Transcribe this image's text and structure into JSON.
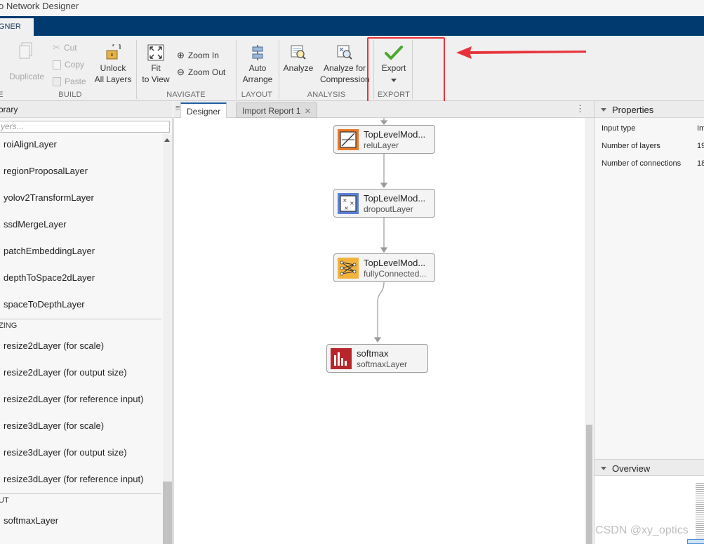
{
  "window": {
    "title": "o Network Designer"
  },
  "app_tab": {
    "label": "GNER"
  },
  "toolstrip": {
    "duplicate": "Duplicate",
    "cut": "Cut",
    "copy": "Copy",
    "paste": "Paste",
    "unlock_line1": "Unlock",
    "unlock_line2": "All Layers",
    "fit_line1": "Fit",
    "fit_line2": "to View",
    "zoom_in": "Zoom In",
    "zoom_out": "Zoom Out",
    "auto_line1": "Auto",
    "auto_line2": "Arrange",
    "analyze": "Analyze",
    "analyze_for_line1": "Analyze for",
    "analyze_for_line2": "Compression",
    "export": "Export",
    "sections": {
      "partial": "E",
      "build": "BUILD",
      "navigate": "NAVIGATE",
      "layout": "LAYOUT",
      "analysis": "ANALYSIS",
      "export": "EXPORT"
    }
  },
  "library": {
    "header": "orary",
    "search_placeholder": "yers...",
    "items": [
      "roiAlignLayer",
      "regionProposalLayer",
      "yolov2TransformLayer",
      "ssdMergeLayer",
      "patchEmbeddingLayer",
      "depthToSpace2dLayer",
      "spaceToDepthLayer"
    ],
    "category_resizing": "ZING",
    "resizing_items": [
      "resize2dLayer (for scale)",
      "resize2dLayer (for output size)",
      "resize2dLayer (for reference input)",
      "resize3dLayer (for scale)",
      "resize3dLayer (for output size)",
      "resize3dLayer (for reference input)"
    ],
    "category_output": "UT",
    "output_items": [
      "softmaxLayer"
    ]
  },
  "doc_tabs": {
    "designer": "Designer",
    "import_report": "Import Report 1",
    "close_glyph": "✕",
    "menu_glyph": "⋮",
    "grip_glyph": "≡"
  },
  "nodes": [
    {
      "name": "TopLevelMod...",
      "type": "reluLayer"
    },
    {
      "name": "TopLevelMod...",
      "type": "dropoutLayer"
    },
    {
      "name": "TopLevelMod...",
      "type": "fullyConnected..."
    },
    {
      "name": "softmax",
      "type": "softmaxLayer"
    }
  ],
  "properties": {
    "header": "Properties",
    "rows": [
      {
        "label": "Input type",
        "value": "Im"
      },
      {
        "label": "Number of layers",
        "value": "19"
      },
      {
        "label": "Number of connections",
        "value": "18"
      }
    ]
  },
  "overview": {
    "header": "Overview"
  },
  "watermark": "CSDN @xy_optics",
  "colors": {
    "tabstrip": "#003a6e",
    "highlight_box": "#e8323a",
    "relu_icon": "#e8782a",
    "dropout_icon": "#5a7fd8",
    "fc_icon": "#f2b33d",
    "softmax_icon": "#b8262b"
  }
}
